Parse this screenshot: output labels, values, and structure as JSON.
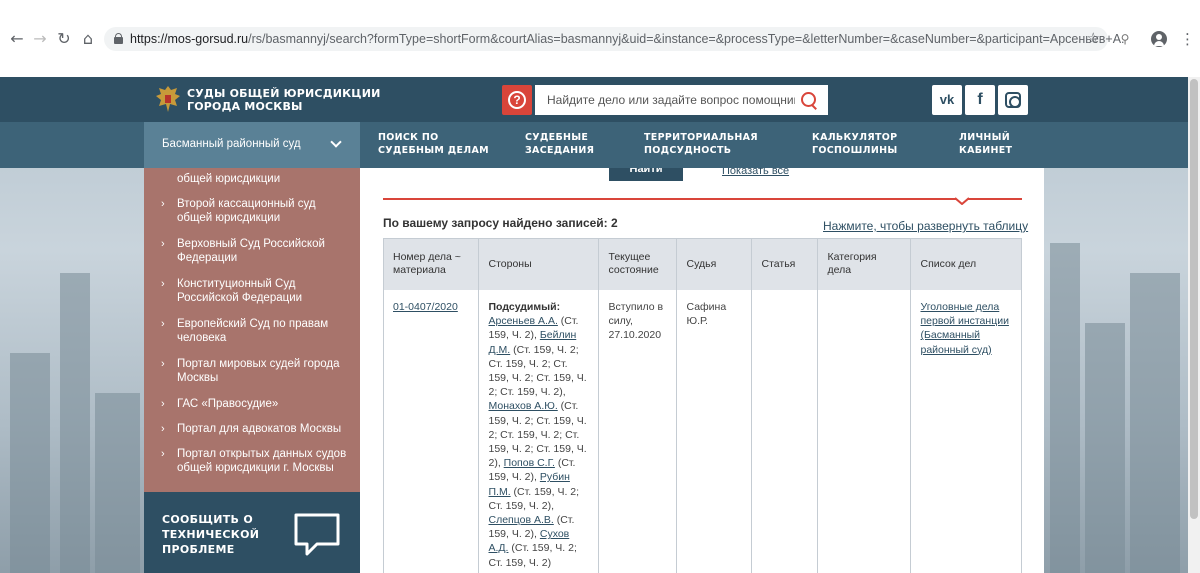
{
  "browser": {
    "url_host": "https://mos-gorsud.ru",
    "url_path": "/rs/basmannyj/search?formType=shortForm&courtAlias=basmannyj&uid=&instance=&processType=&letterNumber=&caseNumber=&participant=Арсеньев+А."
  },
  "header": {
    "title_line1": "СУДЫ ОБЩЕЙ ЮРИСДИКЦИИ",
    "title_line2": "ГОРОДА МОСКВЫ",
    "help_glyph": "?",
    "search_placeholder": "Найдите дело или задайте вопрос помощнику",
    "social": {
      "vk": "vk",
      "fb": "f"
    }
  },
  "nav": {
    "court_select": "Басманный районный суд",
    "items": [
      {
        "line1": "ПОИСК ПО",
        "line2": "СУДЕБНЫМ ДЕЛАМ"
      },
      {
        "line1": "СУДЕБНЫЕ",
        "line2": "ЗАСЕДАНИЯ"
      },
      {
        "line1": "ТЕРРИТОРИАЛЬНАЯ",
        "line2": "ПОДСУДНОСТЬ"
      },
      {
        "line1": "КАЛЬКУЛЯТОР",
        "line2": "ГОСПОШЛИНЫ"
      },
      {
        "line1": "ЛИЧНЫЙ",
        "line2": "КАБИНЕТ"
      }
    ]
  },
  "sidebar": {
    "bullet": "›",
    "items": [
      {
        "line1": "общей юрисдикции",
        "line2": ""
      },
      {
        "line1": "Второй кассационный суд",
        "line2": "общей юрисдикции"
      },
      {
        "line1": "Верховный Суд Российской",
        "line2": "Федерации"
      },
      {
        "line1": "Конституционный Суд",
        "line2": "Российской Федерации"
      },
      {
        "line1": "Европейский Суд по правам",
        "line2": "человека"
      },
      {
        "line1": "Портал мировых судей города",
        "line2": "Москвы"
      },
      {
        "line1": "ГАС «Правосудие»",
        "line2": ""
      },
      {
        "line1": "Портал для адвокатов Москвы",
        "line2": ""
      },
      {
        "line1": "Портал открытых данных судов",
        "line2": "общей юрисдикции г. Москвы"
      }
    ],
    "report_line1": "СООБЩИТЬ О",
    "report_line2": "ТЕХНИЧЕСКОЙ",
    "report_line3": "ПРОБЛЕМЕ"
  },
  "search": {
    "find_button": "Найти",
    "show_all": "Показать все",
    "found_text": "По вашему запросу найдено записей: 2",
    "expand_link": "Нажмите, чтобы развернуть таблицу"
  },
  "table": {
    "headers": [
      "Номер дела ~ материала",
      "Стороны",
      "Текущее состояние",
      "Судья",
      "Статья",
      "Категория дела",
      "Список дел"
    ],
    "row1": {
      "case_number": "01-0407/2020",
      "party_role": "Подсудимый:",
      "parties": [
        {
          "name": "Арсеньев А.А.",
          "charges": " (Ст. 159, Ч. 2), "
        },
        {
          "name": "Бейлин Д.М.",
          "charges": " (Ст. 159, Ч. 2; Ст. 159, Ч. 2; Ст. 159, Ч. 2; Ст. 159, Ч. 2; Ст. 159, Ч. 2), "
        },
        {
          "name": "Монахов А.Ю.",
          "charges": " (Ст. 159, Ч. 2; Ст. 159, Ч. 2; Ст. 159, Ч. 2; Ст. 159, Ч. 2; Ст. 159, Ч. 2), "
        },
        {
          "name": "Попов С.Г.",
          "charges": " (Ст. 159, Ч. 2), "
        },
        {
          "name": "Рубин П.М.",
          "charges": " (Ст. 159, Ч. 2; Ст. 159, Ч. 2), "
        },
        {
          "name": "Слепцов А.В.",
          "charges": " (Ст. 159, Ч. 2), "
        },
        {
          "name": "Сухов А.Д.",
          "charges": " (Ст. 159, Ч. 2; Ст. 159, Ч. 2)"
        }
      ],
      "status": "Вступило в силу, 27.10.2020",
      "judge": "Сафина Ю.Р.",
      "article": "",
      "category": "",
      "case_list": "Уголовные дела первой инстанции (Басманный районный суд)"
    }
  }
}
